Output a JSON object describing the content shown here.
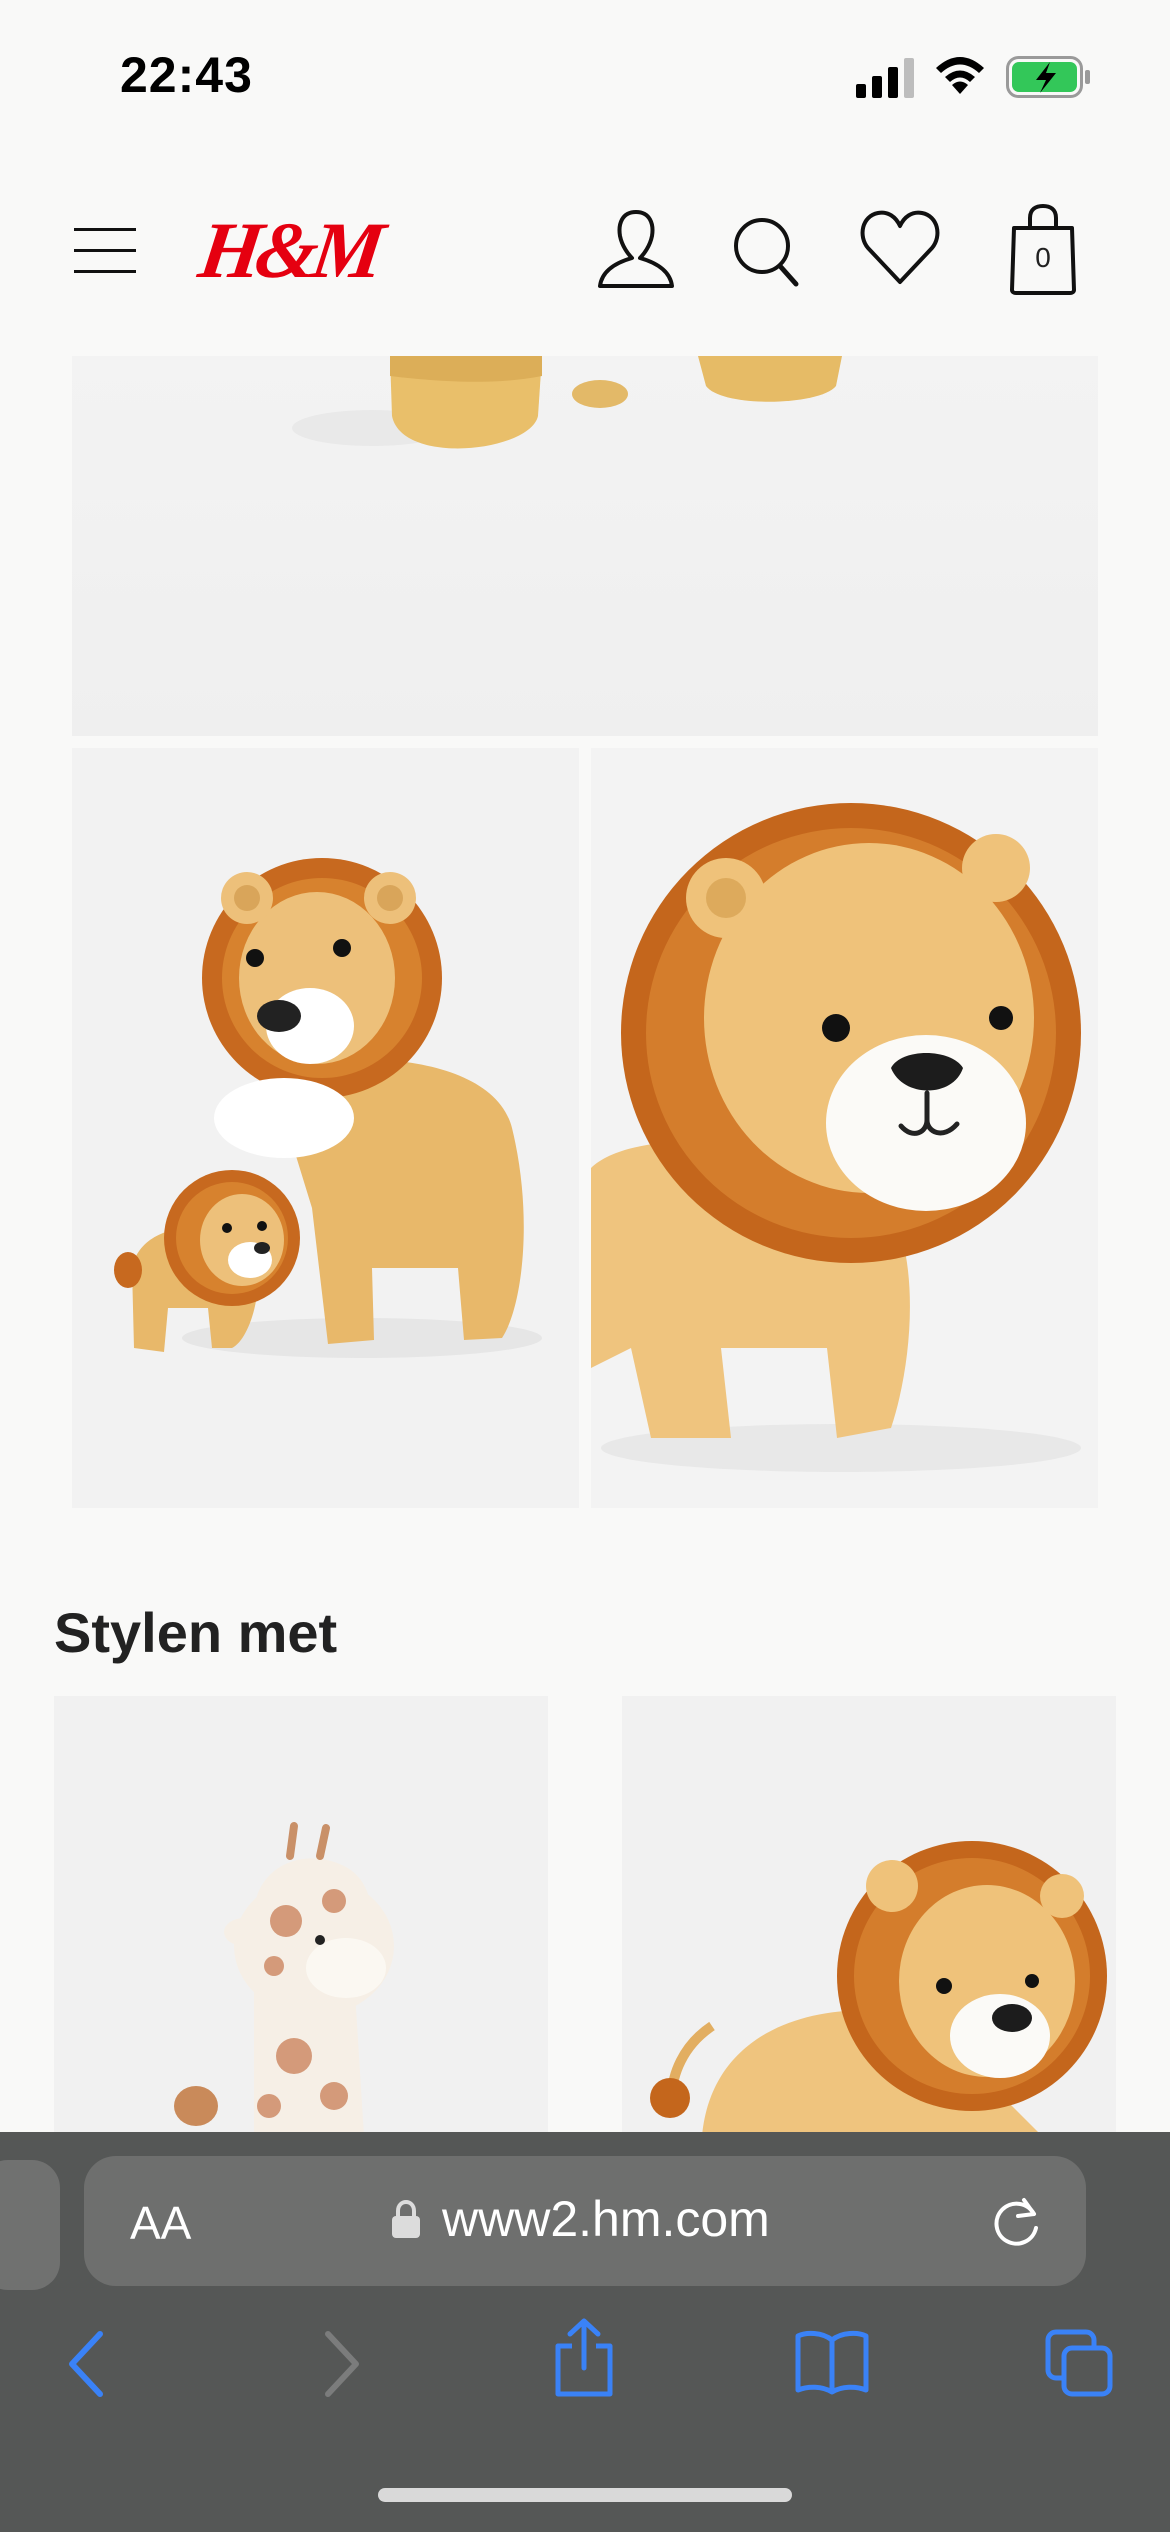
{
  "status_bar": {
    "time": "22:43",
    "icons": [
      "cellular-signal-icon",
      "wifi-icon",
      "battery-charging-icon"
    ]
  },
  "header": {
    "logo_text": "H&M",
    "bag_count": "0",
    "icons": [
      "menu-icon",
      "account-icon",
      "search-icon",
      "heart-icon",
      "shopping-bag-icon"
    ],
    "brand_color": "#e50010"
  },
  "gallery": {
    "images": [
      "lion-plush-feet-closeup",
      "lion-plush-set-large-and-small",
      "lion-plush-face-closeup"
    ]
  },
  "recommendations": {
    "title": "Stylen met",
    "items": [
      "giraffe-plush",
      "lion-plush-lying"
    ]
  },
  "browser": {
    "text_size_label": "AA",
    "url": "www2.hm.com",
    "accent_color": "#3a82f7",
    "icons": [
      "lock-icon",
      "reload-icon",
      "back-icon",
      "forward-icon",
      "share-icon",
      "bookmarks-icon",
      "tabs-icon"
    ]
  }
}
